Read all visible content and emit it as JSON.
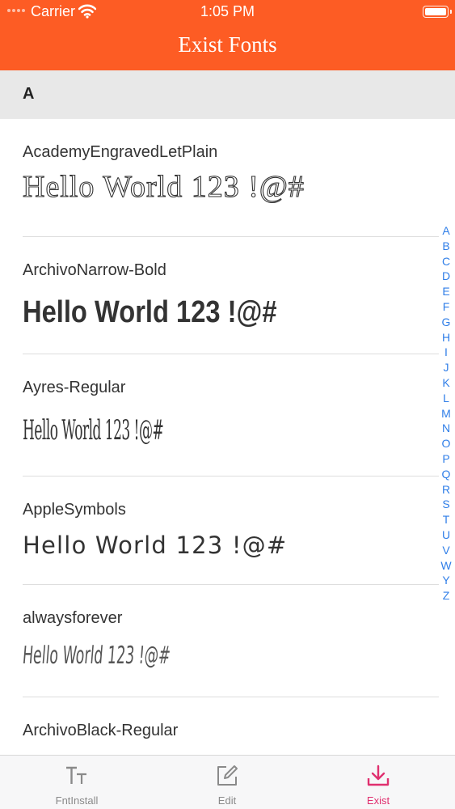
{
  "status_bar": {
    "carrier": "Carrier",
    "time": "1:05 PM"
  },
  "nav": {
    "title": "Exist Fonts"
  },
  "section": {
    "letter": "A"
  },
  "sample_text": "Hello World 123 !@#",
  "fonts": [
    {
      "name": "AcademyEngravedLetPlain",
      "sample": "Hello World 123 !@#"
    },
    {
      "name": "ArchivoNarrow-Bold",
      "sample": "Hello World 123 !@#"
    },
    {
      "name": "Ayres-Regular",
      "sample": "Hello World 123 !@#"
    },
    {
      "name": "AppleSymbols",
      "sample": "Hello World 123 !@#"
    },
    {
      "name": "alwaysforever",
      "sample": "Hello World 123 !@#"
    },
    {
      "name": "ArchivoBlack-Regular"
    }
  ],
  "index_letters": [
    "A",
    "B",
    "C",
    "D",
    "E",
    "F",
    "G",
    "H",
    "I",
    "J",
    "K",
    "L",
    "M",
    "N",
    "O",
    "P",
    "Q",
    "R",
    "S",
    "T",
    "U",
    "V",
    "W",
    "Y",
    "Z"
  ],
  "tabs": [
    {
      "label": "FntInstall",
      "icon": "text-size-icon"
    },
    {
      "label": "Edit",
      "icon": "edit-icon"
    },
    {
      "label": "Exist",
      "icon": "download-icon",
      "active": true
    }
  ],
  "colors": {
    "accent": "#fd5c24",
    "index": "#2f7ee8",
    "active_tab": "#e0306f"
  }
}
